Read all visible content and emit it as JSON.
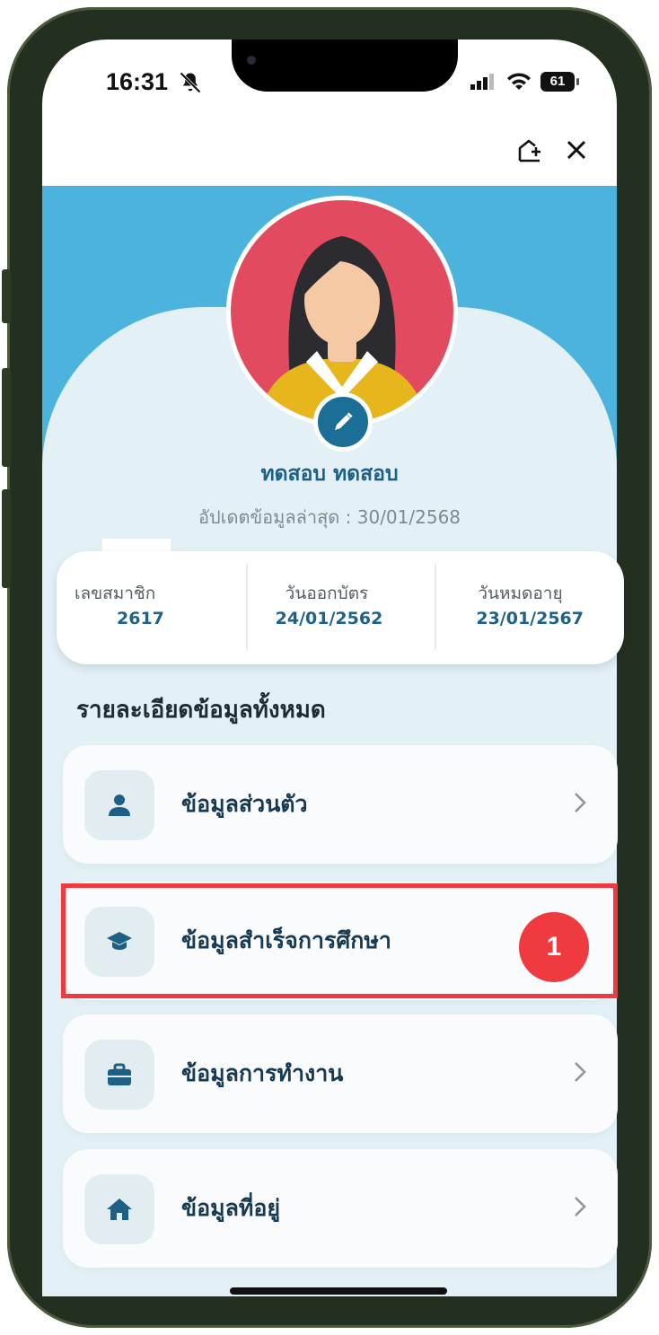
{
  "status_bar": {
    "time": "16:31",
    "battery": "61"
  },
  "profile": {
    "name": "ทดสอบ ทดสอบ",
    "last_updated": "อัปเดตข้อมูลล่าสุด : 30/01/2568"
  },
  "info": [
    {
      "label": "เลขสมาชิก",
      "value": "2617"
    },
    {
      "label": "วันออกบัตร",
      "value": "24/01/2562"
    },
    {
      "label": "วันหมดอายุ",
      "value": "23/01/2567"
    }
  ],
  "section_title": "รายละเอียดข้อมูลทั้งหมด",
  "menu": [
    {
      "label": "ข้อมูลส่วนตัว",
      "icon": "person-icon"
    },
    {
      "label": "ข้อมูลสำเร็จการศึกษา",
      "icon": "graduation-cap-icon"
    },
    {
      "label": "ข้อมูลการทำงาน",
      "icon": "briefcase-icon"
    },
    {
      "label": "ข้อมูลที่อยู่",
      "icon": "home-icon"
    }
  ],
  "step_badge": "1",
  "colors": {
    "header_blue": "#4bb3dc",
    "accent": "#1e628a",
    "highlight": "#ef3b3f"
  }
}
